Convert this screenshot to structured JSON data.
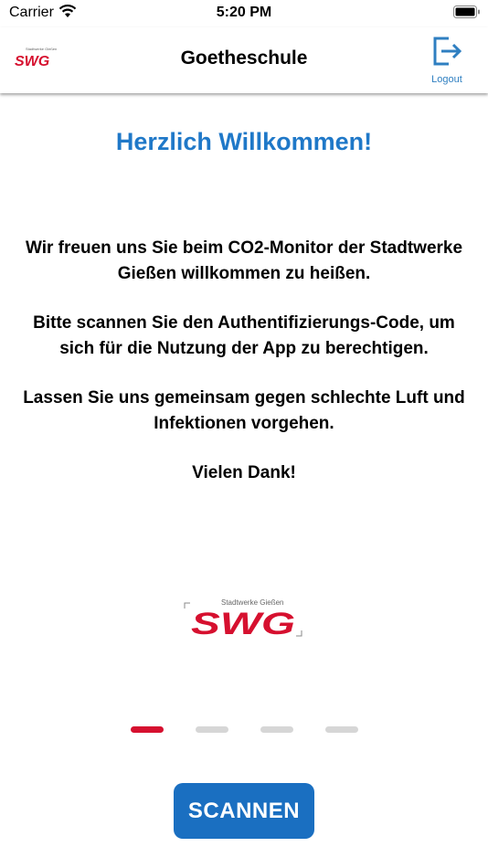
{
  "status": {
    "carrier": "Carrier",
    "time": "5:20 PM"
  },
  "header": {
    "title": "Goetheschule",
    "logout_label": "Logout"
  },
  "logo": {
    "text": "SWG",
    "subtitle": "Stadtwerke Gießen",
    "color": "#d6102f"
  },
  "welcome": {
    "title": "Herzlich Willkommen!"
  },
  "body": {
    "p1": "Wir freuen uns Sie beim CO2-Monitor der Stadtwerke Gießen willkommen zu heißen.",
    "p2": "Bitte scannen Sie den Authentifizierungs-Code, um sich für die Nutzung der App zu berechtigen.",
    "p3": "Lassen Sie uns gemeinsam gegen schlechte Luft und Infektionen vorgehen.",
    "p4": "Vielen Dank!"
  },
  "pager": {
    "count": 4,
    "active_index": 0
  },
  "actions": {
    "scan_label": "SCANNEN"
  },
  "colors": {
    "accent_blue": "#1f78c8",
    "button_blue": "#1a6fc1",
    "brand_red": "#d6102f"
  }
}
